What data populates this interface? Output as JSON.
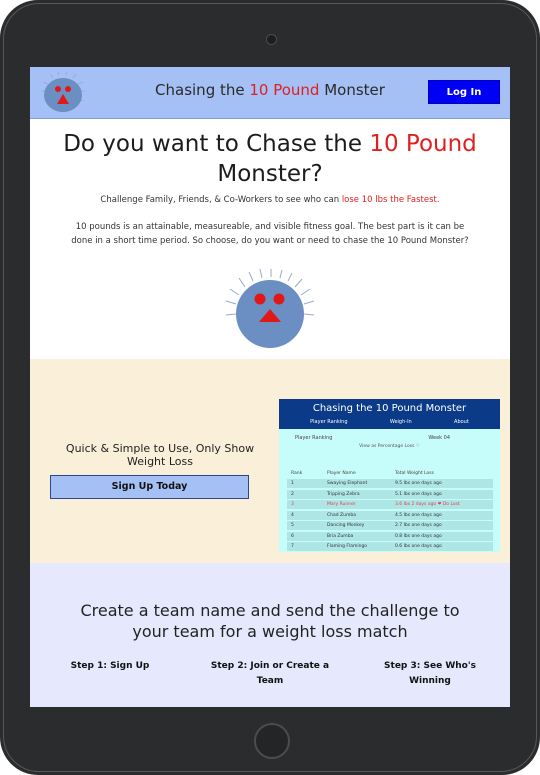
{
  "header": {
    "title_prefix": "Chasing the ",
    "title_highlight": "10 Pound",
    "title_suffix": " Monster",
    "login_label": "Log In"
  },
  "hero": {
    "heading_prefix": "Do you want to Chase the ",
    "heading_highlight": "10 Pound",
    "heading_suffix": " Monster?",
    "sub_prefix": "Challenge Family, Friends, & Co-Workers to see who can ",
    "sub_highlight": "lose 10 lbs the Fastest.",
    "description": "10 pounds is an attainable, measureable, and visible fitness goal. The best part is it can be done in a short time period. So choose, do you want or need to chase the 10 Pound Monster?"
  },
  "promo": {
    "tagline": "Quick & Simple to Use, Only Show Weight Loss",
    "signup_label": "Sign Up Today"
  },
  "preview": {
    "title": "Chasing the 10 Pound Monster",
    "nav": [
      "Player Ranking",
      "Weigh-In",
      "About"
    ],
    "section_label": "Player Ranking",
    "week_label": "Week 04",
    "note": "View as Percentage Loss",
    "columns": [
      "Rank",
      "Player Name",
      "Total Weight Loss"
    ],
    "rows": [
      {
        "rank": "1",
        "name": "Swaying Elephant",
        "loss": "9.5 lbs one days ago"
      },
      {
        "rank": "2",
        "name": "Tripping Zebra",
        "loss": "5.1 lbs one days ago"
      },
      {
        "rank": "3",
        "name": "Mary Runner",
        "loss": "3.6 lbs 2 days ago ❤ Do Lost"
      },
      {
        "rank": "4",
        "name": "Chad Zumba",
        "loss": "4.5 lbs one days ago"
      },
      {
        "rank": "5",
        "name": "Dancing Monkey",
        "loss": "2.7 lbs one days ago"
      },
      {
        "rank": "6",
        "name": "Bria Zumba",
        "loss": "0.8 lbs one days ago"
      },
      {
        "rank": "7",
        "name": "Flaming Flamingo",
        "loss": "0.6 lbs one days ago"
      }
    ]
  },
  "how": {
    "title": "Create a team name and send the challenge to your team for a weight loss match",
    "steps": [
      "Step 1: Sign Up",
      "Step 2: Join or Create a Team",
      "Step 3: See Who's Winning"
    ]
  },
  "colors": {
    "accent_red": "#e02020",
    "header_blue": "#a4c0f4",
    "login_blue": "#0000f2",
    "monster_blue": "#6b8fc3"
  },
  "icons": [
    "monster-logo-icon",
    "monster-mascot-icon",
    "heart-icon"
  ]
}
